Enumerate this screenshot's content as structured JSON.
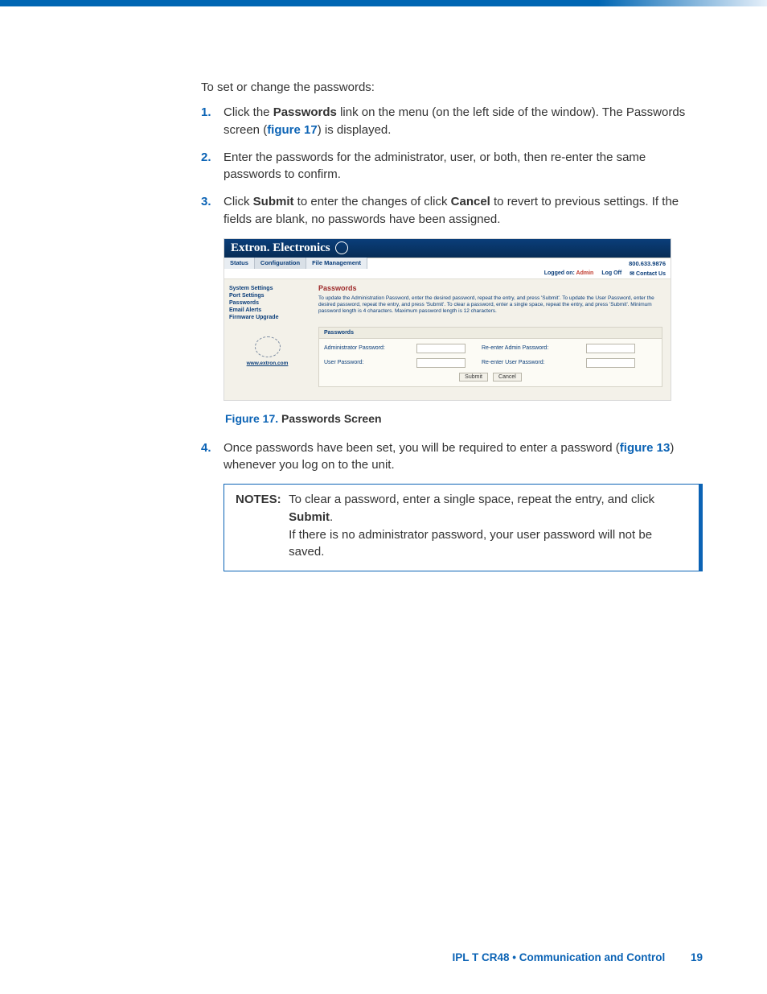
{
  "intro": "To set or change the passwords:",
  "steps": [
    {
      "num": "1.",
      "pre": "Click the ",
      "bold1": "Passwords",
      "mid": " link on the menu (on the left side of the window). The Passwords screen (",
      "link": "figure 17",
      "post": ") is displayed."
    },
    {
      "num": "2.",
      "text": "Enter the passwords for the administrator, user, or both, then re-enter the same passwords to confirm."
    },
    {
      "num": "3.",
      "pre": "Click ",
      "bold1": "Submit",
      "mid": " to enter the changes of click ",
      "bold2": "Cancel",
      "post": " to revert to previous settings. If the fields are blank, no passwords have been assigned."
    }
  ],
  "shot": {
    "brand": "Extron. Electronics",
    "tabs": [
      "Status",
      "Configuration",
      "File Management"
    ],
    "phone": "800.633.9876",
    "logged_label": "Logged on:",
    "logged_value": "Admin",
    "logoff": "Log Off",
    "contact": "Contact Us",
    "sidebar": [
      "System Settings",
      "Port Settings",
      "Passwords",
      "Email Alerts",
      "Firmware Upgrade"
    ],
    "sidelink": "www.extron.com",
    "title": "Passwords",
    "help": "To update the Administration Password, enter the desired password, repeat the entry, and press 'Submit'. To update the User Password, enter the desired password, repeat the entry, and press 'Submit'. To clear a password, enter a single space, repeat the entry, and press 'Submit'. Minimum password length is 4 characters. Maximum password length is 12 characters.",
    "panel_hd": "Passwords",
    "admin_lbl": "Administrator Password:",
    "admin_re_lbl": "Re-enter Admin Password:",
    "user_lbl": "User Password:",
    "user_re_lbl": "Re-enter User Password:",
    "submit": "Submit",
    "cancel": "Cancel"
  },
  "caption": {
    "lead": "Figure 17.",
    "ttl": "Passwords Screen"
  },
  "step4": {
    "num": "4.",
    "pre": "Once passwords have been set, you will be required to enter a password (",
    "link": "figure 13",
    "post": ") whenever you log on to the unit."
  },
  "notes": {
    "label": "NOTES:",
    "n1a": "To clear a password, enter a single space, repeat the entry, and click ",
    "n1b": "Submit",
    "n1c": ".",
    "n2": "If there is no administrator password, your user password will not be saved."
  },
  "footer": {
    "doc": "IPL T CR48 • Communication and Control",
    "page": "19"
  }
}
